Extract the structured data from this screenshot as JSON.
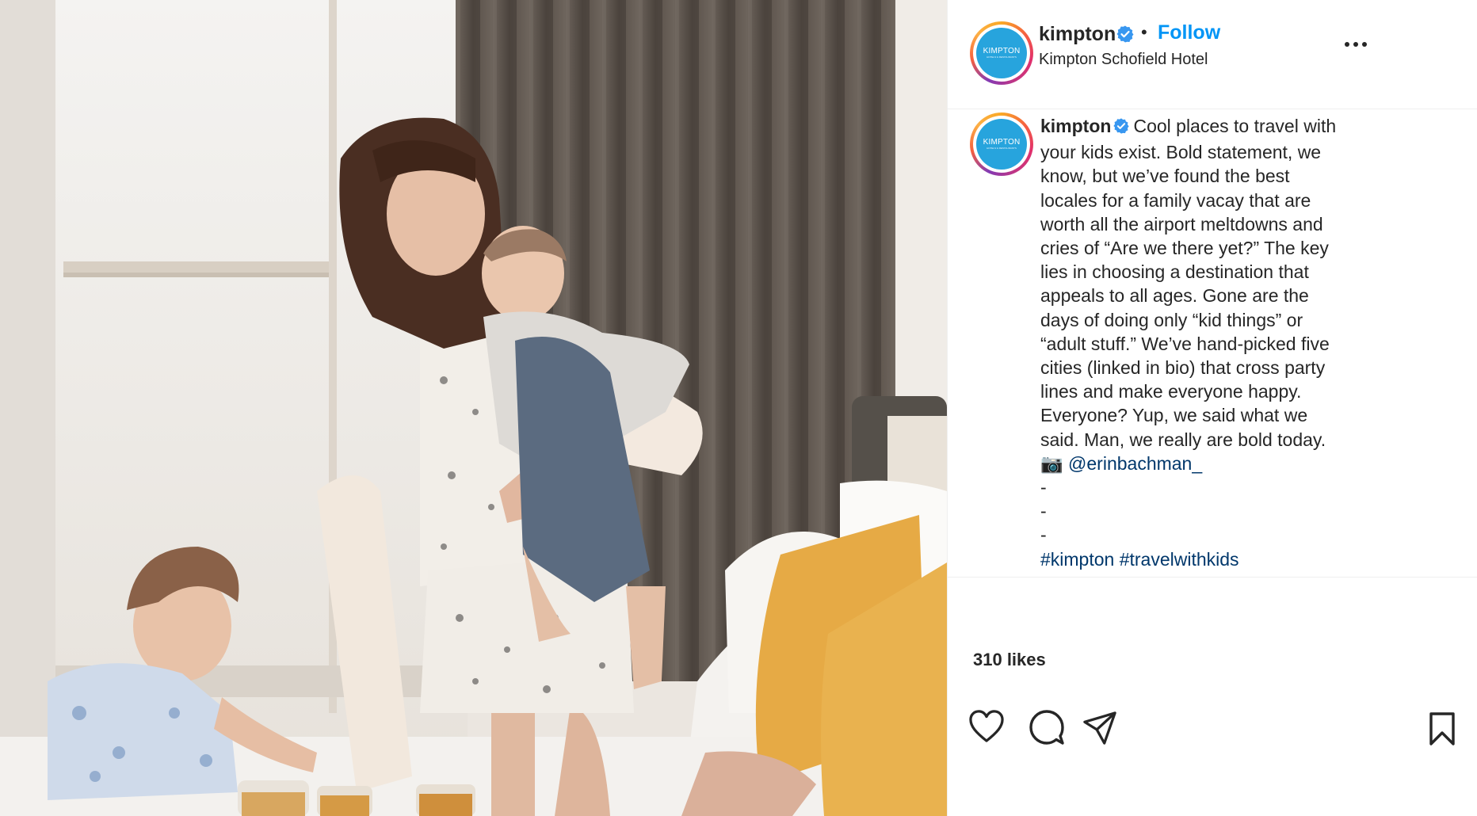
{
  "photo": {
    "alt_icon": "photo-of-family-in-hotel-room"
  },
  "header": {
    "avatar_logo_text": "KIMPTON",
    "avatar_logo_sub": "HOTELS & RESTAURANTS",
    "username": "kimpton",
    "verified_icon": "verified-badge-icon",
    "separator": "•",
    "follow_label": "Follow",
    "location": "Kimpton Schofield Hotel",
    "more_icon": "more-options-icon"
  },
  "caption": {
    "username": "kimpton",
    "lines": [
      "Cool places to travel with",
      "your kids exist. Bold statement, we",
      "know, but we’ve found the best",
      "locales for a family vacay that are",
      "worth all the airport meltdowns and",
      "cries of “Are we there yet?” The key",
      "lies in choosing a destination that",
      "appeals to all ages. Gone are the",
      "days of doing only “kid things” or",
      "“adult stuff.” We’ve hand-picked five",
      "cities (linked in bio) that cross party",
      "lines and make everyone happy.",
      "Everyone? Yup, we said what we",
      "said. Man, we really are bold today."
    ],
    "camera_emoji": "📷",
    "mention": "@erinbachman_",
    "dashes": [
      "-",
      "-",
      "-"
    ],
    "hashtags": [
      "#kimpton",
      "#travelwithkids"
    ]
  },
  "actions": {
    "like_icon": "heart-icon",
    "comment_icon": "comment-icon",
    "share_icon": "share-icon",
    "save_icon": "bookmark-icon"
  },
  "likes_text": "310 likes",
  "colors": {
    "link": "#00376b",
    "follow": "#0095f6",
    "verified": "#3897f0",
    "brand": "#27a4dd"
  }
}
